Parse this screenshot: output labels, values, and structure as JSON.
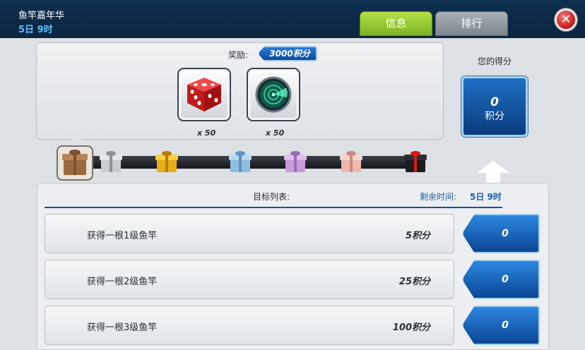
{
  "header": {
    "event_title": "鱼竿嘉年华",
    "event_time": "5日 9时",
    "tabs": [
      "信息",
      "排行"
    ],
    "close_icon": "close-icon"
  },
  "reward": {
    "label": "奖励:",
    "badge": "3000积分",
    "items": [
      {
        "icon": "red-dice-icon",
        "quantity": "x 50"
      },
      {
        "icon": "radar-sonar-icon",
        "quantity": "x 50"
      }
    ]
  },
  "score": {
    "label": "您的得分",
    "value": "0",
    "unit": "积分"
  },
  "progress": {
    "gift_icons": [
      "wooden-gift-icon",
      "silver-gift-icon",
      "gold-gift-icon",
      "blue-gift-icon",
      "purple-gift-icon",
      "pink-gift-icon",
      "black-gift-icon"
    ],
    "current_index": 0
  },
  "goals": {
    "title": "目标列表:",
    "remaining_label": "剩余时间:",
    "remaining_value": "5日 9时",
    "rows": [
      {
        "text": "获得一根1级鱼竿",
        "points": "5积分",
        "progress": "0"
      },
      {
        "text": "获得一根2级鱼竿",
        "points": "25积分",
        "progress": "0"
      },
      {
        "text": "获得一根3级鱼竿",
        "points": "100积分",
        "progress": "0"
      }
    ]
  },
  "colors": {
    "header_bg": "#0f2f4f",
    "tab_active": "#9ccb34",
    "tab_inactive": "#8e959c",
    "badge_blue": "#1b63b8",
    "time_accent": "#1a5fa8",
    "close_red": "#d42020"
  }
}
